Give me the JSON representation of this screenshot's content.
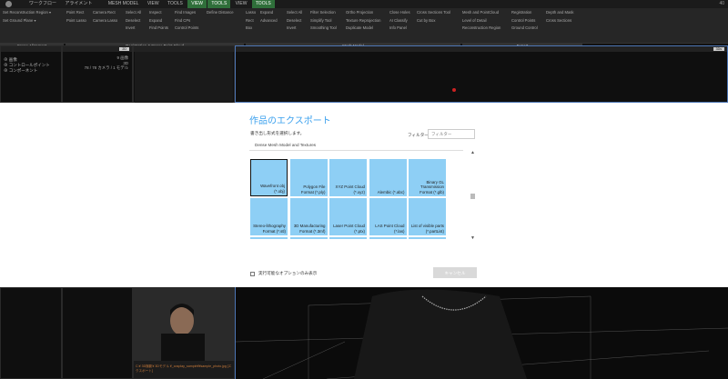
{
  "menubar": {
    "items": [
      "ワークフロー",
      "アライメント",
      "MESH MODEL",
      "VIEW",
      "TOOLS",
      "VIEW",
      "TOOLS",
      "VIEW",
      "TOOLS"
    ],
    "active_indices": [
      5,
      6,
      8
    ],
    "right_status": "40"
  },
  "ribbon": {
    "columns": [
      [
        "Set Reconstruction Region ▾",
        "Set Ground Plane ▾",
        ""
      ],
      [
        "Point Rect",
        "Point Lasso",
        ""
      ],
      [
        "Camera Rect",
        "Camera Lasso",
        ""
      ],
      [
        "Select All",
        "Deselect",
        "Invert"
      ],
      [
        "Inspect",
        "Expand",
        "Find Points"
      ],
      [
        "Find Images",
        "Find CPs",
        "Control Points"
      ],
      [
        "Define Distance",
        ""
      ],
      [
        "Lasso",
        "Rect",
        "Box"
      ],
      [
        "Expand",
        "Advanced",
        ""
      ],
      [
        "Select All",
        "Deselect",
        "Invert"
      ],
      [
        "Filter Selection",
        "Simplify Tool",
        "Smoothing Tool"
      ],
      [
        "Ortho Projection",
        "Texture Reprojection",
        "Duplicate Model"
      ],
      [
        "Close Holes",
        "AI Classify",
        "Info Panel"
      ],
      [
        "Cross Sections Tool",
        "Cut by Box",
        ""
      ],
      [
        "Mesh and PointCloud",
        "Level of Detail",
        "Reconstruction Region"
      ],
      [
        "Registration",
        "Control Points",
        "Ground Control"
      ],
      [
        "Depth and Mask",
        "Cross Sections",
        ""
      ]
    ],
    "groups": [
      "Scene Alignment",
      "Registration & Space Point Cloud",
      "Mesh Model",
      "Export"
    ]
  },
  "left_panel": {
    "badge": "2D",
    "tree": [
      "⊕ 画像",
      "⊕ コントロールポイント",
      "⊕ コンポーネント"
    ],
    "info_lines": [
      "9 画像",
      "3D",
      "78 / 78 カメラ / 1 モデル"
    ]
  },
  "viewport": {
    "badge": "3Ds"
  },
  "dialog": {
    "title": "作品のエクスポート",
    "subtitle": "書き出し形式を選択します。",
    "filter_label": "フィルター",
    "filter_placeholder": "フィルター",
    "category": "Dense Mesh Model and Textures",
    "tiles": [
      {
        "label": "Wavefront obj (*.obj)",
        "selected": true
      },
      {
        "label": "Polygon File Format (*.ply)",
        "selected": false
      },
      {
        "label": "XYZ Point Cloud (*.xyz)",
        "selected": false
      },
      {
        "label": "Alembic (*.abc)",
        "selected": false
      },
      {
        "label": "Binary GL Transmission Format (*.glb)",
        "selected": false
      },
      {
        "label": "Stereo-lithography Format (*.stl)",
        "selected": false
      },
      {
        "label": "3D Manufacturing Format (*.3mf)",
        "selected": false
      },
      {
        "label": "Laser Point Cloud (*.ptx)",
        "selected": false
      },
      {
        "label": "LAS Point Cloud (*.las)",
        "selected": false
      },
      {
        "label": "List of visible parts (*.partList)",
        "selected": false
      },
      {
        "label": "",
        "selected": false
      },
      {
        "label": "",
        "selected": false
      },
      {
        "label": "",
        "selected": false
      },
      {
        "label": "",
        "selected": false
      },
      {
        "label": "",
        "selected": false
      }
    ],
    "checkbox_label": "実行可能なオプションのみ表示",
    "cancel_label": "キャンセル",
    "accent": "#3aa0ee",
    "tile_color": "#8ecff5"
  },
  "bottom_left": {
    "caption": "C:¥ 3D撮影¥ 3Dモデル ¥_cosplay_sample¥¥sample_photo.jpg [エクスポート]"
  }
}
